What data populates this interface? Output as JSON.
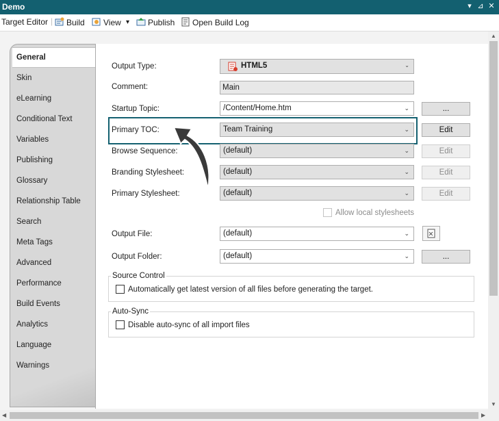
{
  "window": {
    "title": "Demo",
    "menu_glyph": "▾",
    "pin_glyph": "⊿",
    "close_glyph": "✕"
  },
  "toolbar": {
    "target_editor": "Target Editor",
    "build": "Build",
    "view": "View",
    "view_dropdown": "▾",
    "publish": "Publish",
    "open_build_log": "Open Build Log"
  },
  "sidebar": {
    "items": [
      {
        "label": "General",
        "active": true
      },
      {
        "label": "Skin"
      },
      {
        "label": "eLearning"
      },
      {
        "label": "Conditional Text"
      },
      {
        "label": "Variables"
      },
      {
        "label": "Publishing"
      },
      {
        "label": "Glossary"
      },
      {
        "label": "Relationship Table"
      },
      {
        "label": "Search"
      },
      {
        "label": "Meta Tags"
      },
      {
        "label": "Advanced"
      },
      {
        "label": "Performance"
      },
      {
        "label": "Build Events"
      },
      {
        "label": "Analytics"
      },
      {
        "label": "Language"
      },
      {
        "label": "Warnings"
      }
    ]
  },
  "form": {
    "output_type": {
      "label": "Output Type:",
      "value": "HTML5"
    },
    "comment": {
      "label": "Comment:",
      "value": "Main"
    },
    "startup_topic": {
      "label": "Startup Topic:",
      "value": "/Content/Home.htm",
      "button": "..."
    },
    "primary_toc": {
      "label": "Primary TOC:",
      "value": "Team Training",
      "button": "Edit"
    },
    "browse_sequence": {
      "label": "Browse Sequence:",
      "value": "(default)",
      "button": "Edit"
    },
    "branding_stylesheet": {
      "label": "Branding Stylesheet:",
      "value": "(default)",
      "button": "Edit"
    },
    "primary_stylesheet": {
      "label": "Primary Stylesheet:",
      "value": "(default)",
      "button": "Edit"
    },
    "allow_local": {
      "label": "Allow local stylesheets",
      "checked": false
    },
    "output_file": {
      "label": "Output File:",
      "value": "(default)"
    },
    "output_folder": {
      "label": "Output Folder:",
      "value": "(default)",
      "button": "..."
    }
  },
  "source_control": {
    "title": "Source Control",
    "option": "Automatically get latest version of all files before generating the target.",
    "checked": false
  },
  "auto_sync": {
    "title": "Auto-Sync",
    "option": "Disable auto-sync of all import files",
    "checked": false
  },
  "colors": {
    "accent": "#136070",
    "highlight": "#136070",
    "html5_icon": "#d63b2b"
  },
  "icons": {
    "build": "build-icon",
    "view": "view-icon",
    "publish": "publish-icon",
    "log": "log-icon",
    "file": "file-icon"
  }
}
